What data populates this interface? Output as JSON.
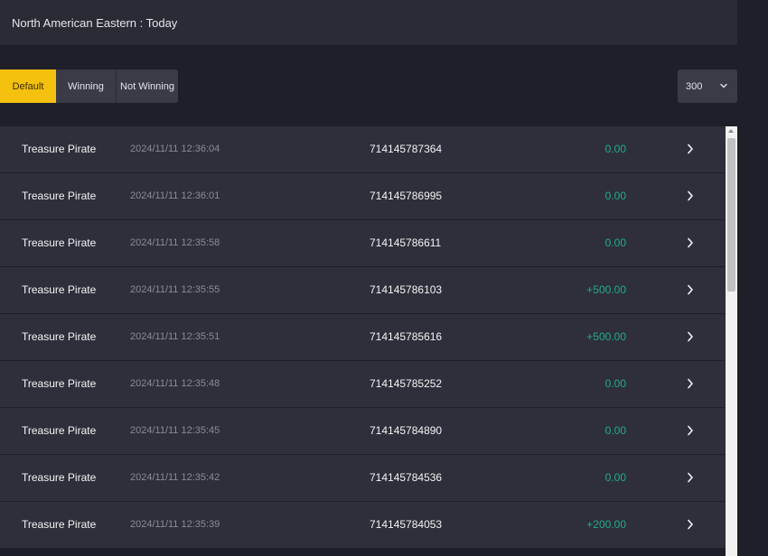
{
  "header": {
    "title": "North American Eastern : Today"
  },
  "filters": {
    "default_label": "Default",
    "winning_label": "Winning",
    "not_winning_label": "Not Winning",
    "active_color": "#f4c10f"
  },
  "page_size": {
    "selected": "300",
    "icon": "chevron-down-icon"
  },
  "records": [
    {
      "game": "Treasure Pirate",
      "time": "2024/11/11 12:36:04",
      "id": "714145787364",
      "amount": "0.00"
    },
    {
      "game": "Treasure Pirate",
      "time": "2024/11/11 12:36:01",
      "id": "714145786995",
      "amount": "0.00"
    },
    {
      "game": "Treasure Pirate",
      "time": "2024/11/11 12:35:58",
      "id": "714145786611",
      "amount": "0.00"
    },
    {
      "game": "Treasure Pirate",
      "time": "2024/11/11 12:35:55",
      "id": "714145786103",
      "amount": "+500.00"
    },
    {
      "game": "Treasure Pirate",
      "time": "2024/11/11 12:35:51",
      "id": "714145785616",
      "amount": "+500.00"
    },
    {
      "game": "Treasure Pirate",
      "time": "2024/11/11 12:35:48",
      "id": "714145785252",
      "amount": "0.00"
    },
    {
      "game": "Treasure Pirate",
      "time": "2024/11/11 12:35:45",
      "id": "714145784890",
      "amount": "0.00"
    },
    {
      "game": "Treasure Pirate",
      "time": "2024/11/11 12:35:42",
      "id": "714145784536",
      "amount": "0.00"
    },
    {
      "game": "Treasure Pirate",
      "time": "2024/11/11 12:35:39",
      "id": "714145784053",
      "amount": "+200.00"
    }
  ],
  "colors": {
    "amount": "#1fae85",
    "row_bg": "#2f2f3b",
    "page_bg": "#1f1f29"
  }
}
